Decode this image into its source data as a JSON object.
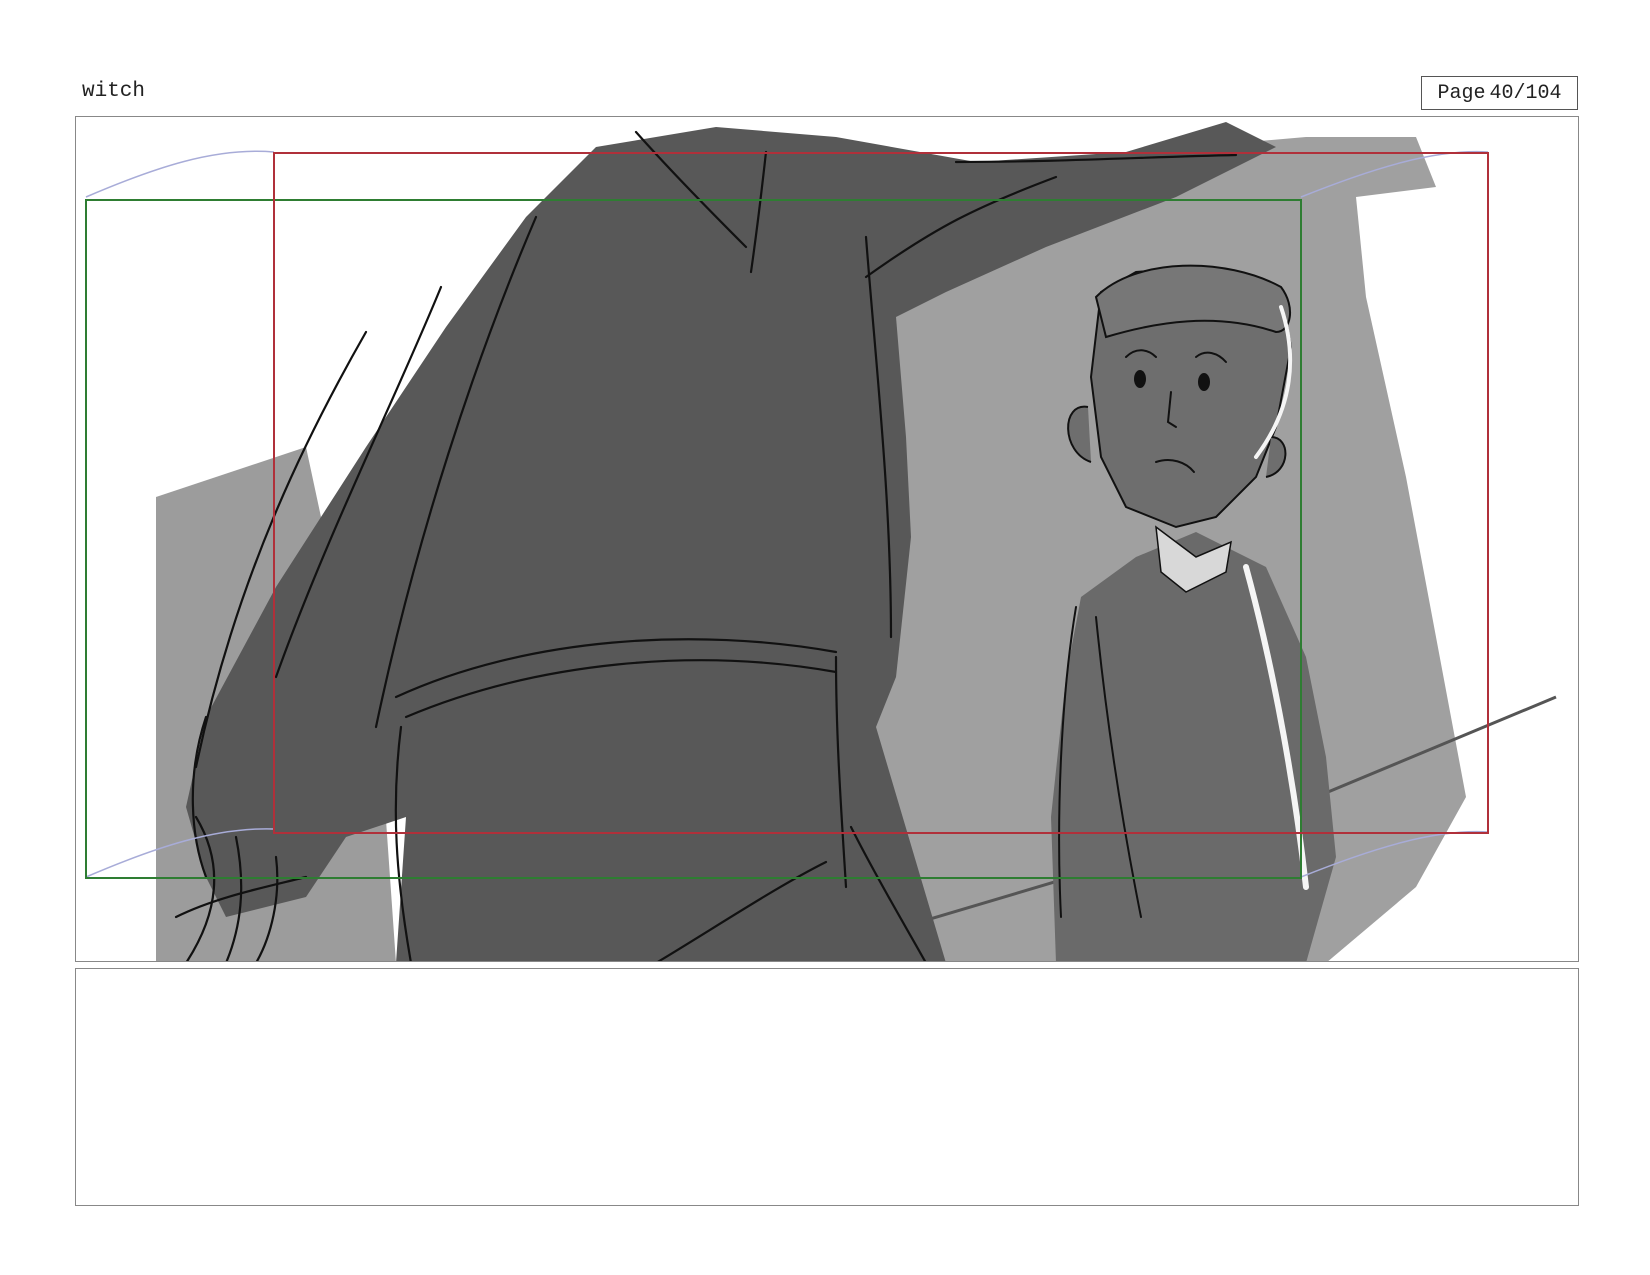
{
  "project": {
    "title": "witch"
  },
  "page": {
    "label": "Page",
    "number": "40/104"
  },
  "panel": {
    "image_description": "storyboard-sketch",
    "colors": {
      "frame_red": "#b0303a",
      "frame_green": "#2e7d32",
      "camera_arrow": "#a8acd8",
      "dark_figure": "#585858",
      "mid_gray": "#a0a0a0",
      "light_gray": "#9a9a9a",
      "line": "#111111"
    }
  },
  "notes": {
    "text": ""
  }
}
